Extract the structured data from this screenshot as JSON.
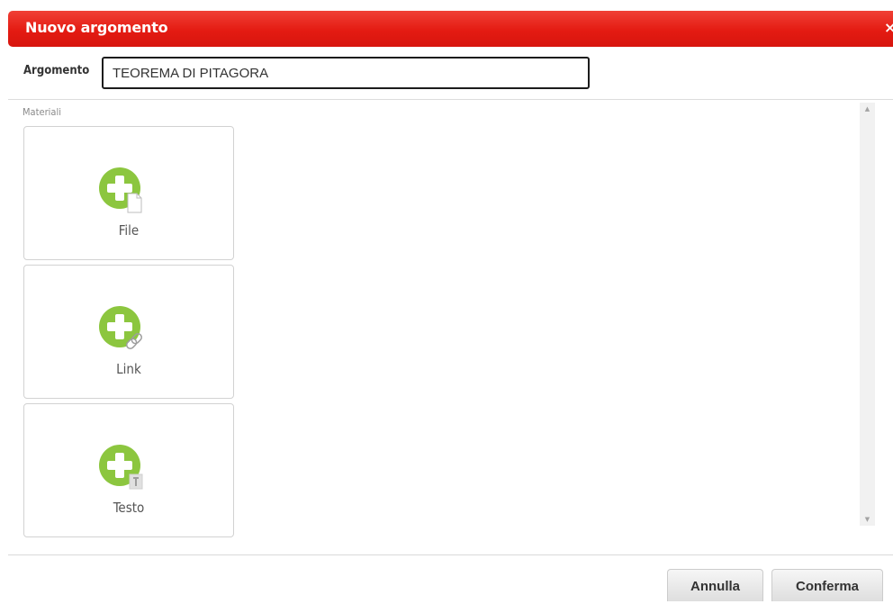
{
  "dialog": {
    "title": "Nuovo argomento",
    "close_label": "×"
  },
  "argomento": {
    "label": "Argomento",
    "value": "TEOREMA DI PITAGORA"
  },
  "materiali": {
    "label": "Materiali",
    "cards": [
      {
        "label": "File",
        "icon": "plus-file-icon"
      },
      {
        "label": "Link",
        "icon": "plus-link-icon"
      },
      {
        "label": "Testo",
        "icon": "plus-text-icon"
      }
    ]
  },
  "scrollbar": {
    "up": "▲",
    "down": "▼"
  },
  "footer": {
    "cancel_label": "Annulla",
    "confirm_label": "Conferma"
  },
  "colors": {
    "header": "#e41b12",
    "plus_green": "#8cc63f"
  }
}
